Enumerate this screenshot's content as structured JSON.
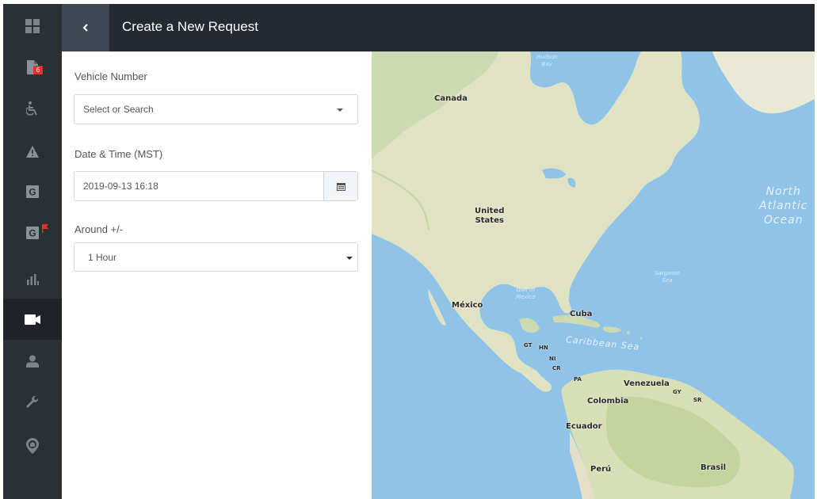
{
  "header": {
    "title": "Create a New Request"
  },
  "sidebar": {
    "items": [
      {
        "icon": "grid-icon"
      },
      {
        "icon": "document-icon",
        "badge": "6"
      },
      {
        "icon": "wheelchair-icon"
      },
      {
        "icon": "warning-icon"
      },
      {
        "icon": "g-box-icon"
      },
      {
        "icon": "g-box-flag-icon"
      },
      {
        "icon": "bar-chart-icon"
      },
      {
        "icon": "video-camera-icon",
        "active": true
      },
      {
        "icon": "user-icon"
      },
      {
        "icon": "wrench-icon"
      },
      {
        "icon": "location-pin-icon"
      }
    ]
  },
  "form": {
    "vehicle": {
      "label": "Vehicle Number",
      "placeholder": "Select or Search"
    },
    "datetime": {
      "label": "Date & Time (MST)",
      "value": "2019-09-13 16:18"
    },
    "around": {
      "label": "Around +/-",
      "value": "1 Hour"
    }
  },
  "map": {
    "labels": {
      "hudson": "Hudson\nBay",
      "canada": "Canada",
      "united_states": "United\nStates",
      "north_atlantic": "North\nAtlantic\nOcean",
      "sargasso": "Sargasso\nSea",
      "gulf": "Gulf of\nMexico",
      "mexico": "México",
      "cuba": "Cuba",
      "caribbean": "Caribbean Sea",
      "gt": "GT",
      "hn": "HN",
      "ni": "NI",
      "cr": "CR",
      "pa": "PA",
      "venezuela": "Venezuela",
      "gy": "GY",
      "sr": "SR",
      "colombia": "Colombia",
      "ecuador": "Ecuador",
      "peru": "Perú",
      "brasil": "Brasil"
    }
  }
}
